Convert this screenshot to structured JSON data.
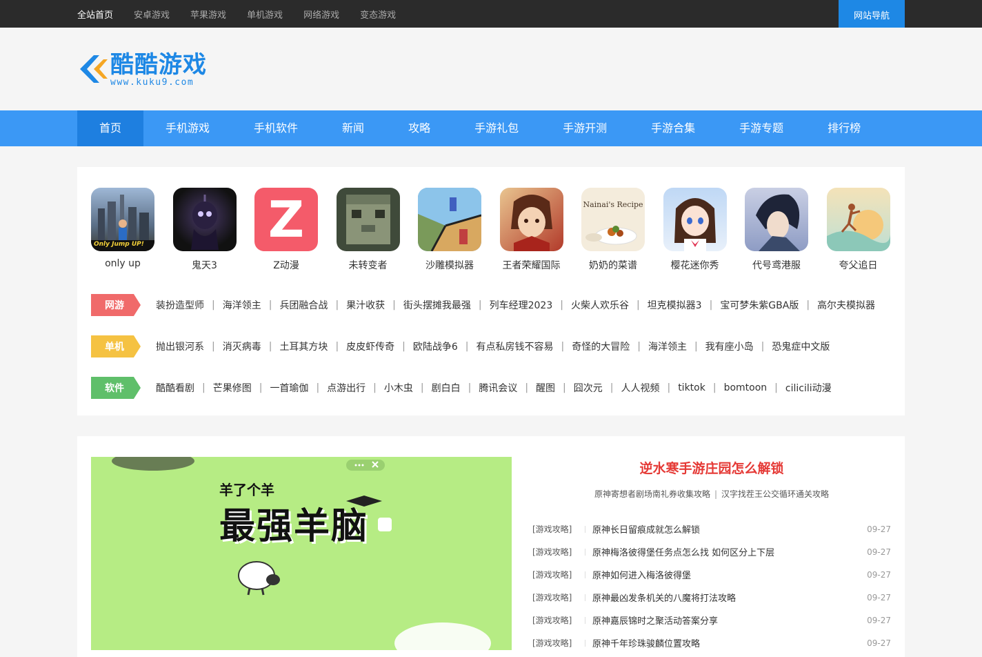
{
  "topbar": {
    "links": [
      "全站首页",
      "安卓游戏",
      "苹果游戏",
      "单机游戏",
      "网络游戏",
      "变态游戏"
    ],
    "site_nav": "网站导航"
  },
  "logo": {
    "title": "酷酷游戏",
    "url": "www.kuku9.com"
  },
  "mainnav": [
    "首页",
    "手机游戏",
    "手机软件",
    "新闻",
    "攻略",
    "手游礼包",
    "手游开测",
    "手游合集",
    "手游专题",
    "排行榜"
  ],
  "apps": [
    {
      "name": "only up",
      "icon_text": "Only Jump UP!"
    },
    {
      "name": "鬼天3",
      "icon_text": ""
    },
    {
      "name": "Z动漫",
      "icon_text": "Z"
    },
    {
      "name": "未转变者",
      "icon_text": ""
    },
    {
      "name": "沙雕模拟器",
      "icon_text": ""
    },
    {
      "name": "王者荣耀国际",
      "icon_text": ""
    },
    {
      "name": "奶奶的菜谱",
      "icon_text": "Nainai's Recipe"
    },
    {
      "name": "樱花迷你秀",
      "icon_text": ""
    },
    {
      "name": "代号鸢港服",
      "icon_text": ""
    },
    {
      "name": "夸父追日",
      "icon_text": ""
    }
  ],
  "rows": {
    "online": {
      "tag": "网游",
      "links": [
        "装扮造型师",
        "海洋领主",
        "兵团融合战",
        "果汁收获",
        "街头摆摊我最强",
        "列车经理2023",
        "火柴人欢乐谷",
        "坦克模拟器3",
        "宝可梦朱紫GBA版",
        "高尔夫模拟器"
      ]
    },
    "single": {
      "tag": "单机",
      "links": [
        "抛出银河系",
        "消灭病毒",
        "土耳其方块",
        "皮皮虾传奇",
        "欧陆战争6",
        "有点私房钱不容易",
        "奇怪的大冒险",
        "海洋领主",
        "我有座小岛",
        "恐鬼症中文版"
      ]
    },
    "software": {
      "tag": "软件",
      "links": [
        "酷酷看剧",
        "芒果修图",
        "一首瑜伽",
        "点游出行",
        "小木虫",
        "剧白白",
        "腾讯会议",
        "醒图",
        "囧次元",
        "人人视频",
        "tiktok",
        "bomtoon",
        "cilicili动漫"
      ]
    }
  },
  "banner": {
    "title_small": "羊了个羊",
    "title_big": "最强羊脑"
  },
  "news": {
    "headline": "逆水寒手游庄园怎么解锁",
    "sub_left": "原神寄想者剧场南礼券收集攻略",
    "sub_right": "汉字找茬王公交循环通关攻略",
    "items": [
      {
        "cat": "[游戏攻略]",
        "title": "原神长日留痕成就怎么解锁",
        "date": "09-27"
      },
      {
        "cat": "[游戏攻略]",
        "title": "原神梅洛彼得堡任务点怎么找 如何区分上下层",
        "date": "09-27"
      },
      {
        "cat": "[游戏攻略]",
        "title": "原神如何进入梅洛彼得堡",
        "date": "09-27"
      },
      {
        "cat": "[游戏攻略]",
        "title": "原神最凶发条机关的八魔将打法攻略",
        "date": "09-27"
      },
      {
        "cat": "[游戏攻略]",
        "title": "原神嘉辰锦时之聚活动答案分享",
        "date": "09-27"
      },
      {
        "cat": "[游戏攻略]",
        "title": "原神千年珍珠骏麟位置攻略",
        "date": "09-27"
      }
    ]
  },
  "colors": {
    "brand_blue": "#1e88e5",
    "nav_blue": "#3b98f5",
    "tag_red": "#f06a6a",
    "tag_yellow": "#f5c242",
    "tag_green": "#5fbf6a",
    "headline_red": "#e53935"
  }
}
